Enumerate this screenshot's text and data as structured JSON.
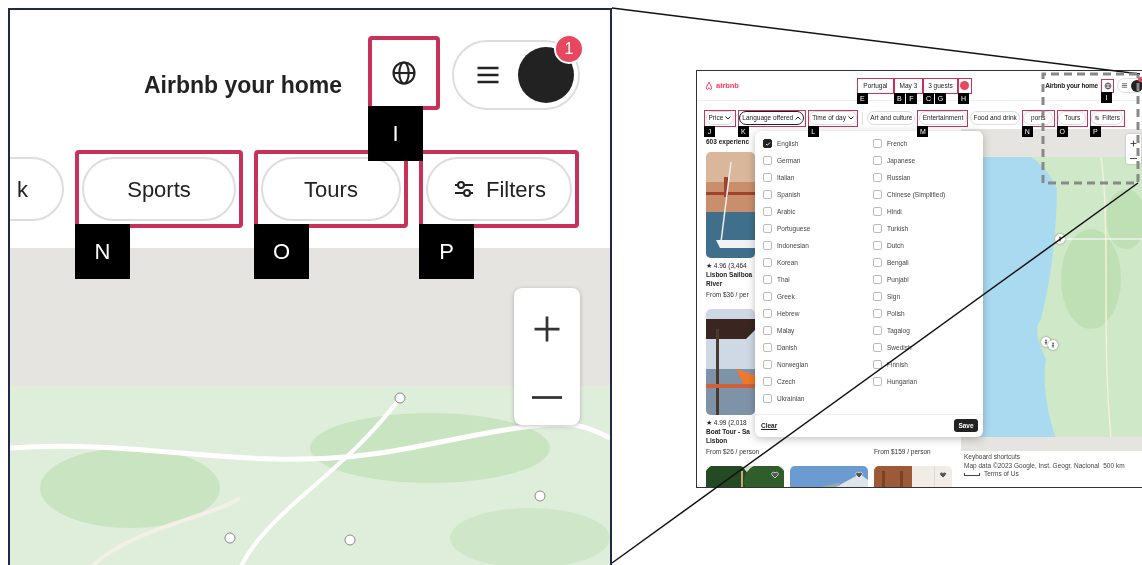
{
  "inset": {
    "host_link": "Airbnb your home",
    "globe_marker": "I",
    "notification_count": "1",
    "categories": [
      {
        "label": "k",
        "kind": "category"
      },
      {
        "label": "Sports",
        "kind": "category",
        "marker": "N"
      },
      {
        "label": "Tours",
        "kind": "category",
        "marker": "O"
      },
      {
        "label": "Filters",
        "kind": "filters",
        "marker": "P"
      }
    ]
  },
  "screenshot": {
    "logo": "airbnb",
    "search": [
      {
        "label": "Portugal",
        "markers": [
          "E"
        ]
      },
      {
        "label": "May 3",
        "markers": [
          "B",
          "F"
        ]
      },
      {
        "label": "3 guests",
        "markers": [
          "C",
          "G"
        ]
      }
    ],
    "search_button_marker": "H",
    "host_link": "Airbnb your home",
    "globe_marker": "I",
    "filters": [
      {
        "label": "Price",
        "kind": "dropdown",
        "expanded": false,
        "marker": "J"
      },
      {
        "label": "Language offered",
        "kind": "dropdown",
        "expanded": true,
        "marker": "K"
      },
      {
        "label": "Time of day",
        "kind": "dropdown",
        "expanded": false,
        "marker": "L"
      },
      {
        "label": "Art and culture",
        "kind": "category"
      },
      {
        "label": "Entertainment",
        "kind": "category",
        "marker": "M"
      },
      {
        "label": "Food and drink",
        "kind": "category"
      },
      {
        "label": "ports",
        "kind": "category",
        "marker": "N"
      },
      {
        "label": "Tours",
        "kind": "category",
        "marker": "O"
      },
      {
        "label": "Filters",
        "kind": "filters",
        "marker": "P"
      }
    ],
    "results_count": "603 experienc",
    "listing_rows": [
      [
        {
          "rating": "★ 4.96 (3,464",
          "title": "Lisbon Sailboa",
          "subtitle": "River",
          "price": "From $36 / per"
        },
        null,
        null
      ],
      [
        {
          "rating": "★ 4.99 (2,018",
          "title": "Boat Tour - Sa",
          "subtitle": "Lisbon",
          "price": "From $26 / person"
        },
        null,
        {
          "price": "From $159 / person"
        }
      ],
      [
        {
          "saved": false
        },
        {
          "saved": false
        },
        {
          "saved": false
        }
      ]
    ],
    "language_menu": {
      "columns": [
        [
          {
            "label": "English",
            "checked": true
          },
          {
            "label": "German",
            "checked": false
          },
          {
            "label": "Italian",
            "checked": false
          },
          {
            "label": "Spanish",
            "checked": false
          },
          {
            "label": "Arabic",
            "checked": false
          },
          {
            "label": "Portuguese",
            "checked": false
          },
          {
            "label": "Indonesian",
            "checked": false
          },
          {
            "label": "Korean",
            "checked": false
          },
          {
            "label": "Thai",
            "checked": false
          },
          {
            "label": "Greek",
            "checked": false
          },
          {
            "label": "Hebrew",
            "checked": false
          },
          {
            "label": "Malay",
            "checked": false
          },
          {
            "label": "Danish",
            "checked": false
          },
          {
            "label": "Norwegian",
            "checked": false
          },
          {
            "label": "Czech",
            "checked": false
          },
          {
            "label": "Ukrainian",
            "checked": false
          }
        ],
        [
          {
            "label": "French",
            "checked": false
          },
          {
            "label": "Japanese",
            "checked": false
          },
          {
            "label": "Russian",
            "checked": false
          },
          {
            "label": "Chinese (Simplified)",
            "checked": false
          },
          {
            "label": "Hindi",
            "checked": false
          },
          {
            "label": "Turkish",
            "checked": false
          },
          {
            "label": "Dutch",
            "checked": false
          },
          {
            "label": "Bengali",
            "checked": false
          },
          {
            "label": "Punjabi",
            "checked": false
          },
          {
            "label": "Sign",
            "checked": false
          },
          {
            "label": "Polish",
            "checked": false
          },
          {
            "label": "Tagalog",
            "checked": false
          },
          {
            "label": "Swedish",
            "checked": false
          },
          {
            "label": "Finnish",
            "checked": false
          },
          {
            "label": "Hungarian",
            "checked": false
          }
        ]
      ],
      "clear": "Clear",
      "save": "Save"
    },
    "map_footer": [
      "Keyboard shortcuts",
      "Map data ©2023 Google, Inst. Geogr. Nacional",
      "500 km",
      "Terms of Us"
    ]
  }
}
